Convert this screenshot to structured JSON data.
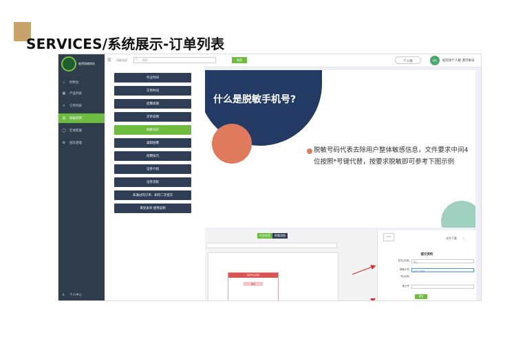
{
  "slide_title": "SERVICES/系统展示-订单列表",
  "colors": {
    "accent_square": "#c9a46a",
    "sidebar": "#2e3c4c",
    "green": "#6dbb3f",
    "navy_button": "#2f3d55",
    "orange": "#e07a5c",
    "navy_shape": "#233b64",
    "teal": "#9fcfbe"
  },
  "sidebar": {
    "logo_text": "蛙壳网络科技",
    "items": [
      {
        "label": "控制台",
        "icon": "home-icon"
      },
      {
        "label": "产品列表",
        "icon": "grid-icon"
      },
      {
        "label": "订单列表",
        "icon": "list-icon"
      },
      {
        "label": "班报说明",
        "icon": "document-icon",
        "active": true
      },
      {
        "label": "在线客服",
        "icon": "user-icon"
      },
      {
        "label": "团队管理",
        "icon": "team-icon"
      }
    ],
    "footer": {
      "label": "个人中心",
      "icon": "person-icon"
    }
  },
  "topbar": {
    "select_label": "班级全部",
    "search_placeholder": "搜索",
    "search_button": "搜索",
    "personal_button": "个人版",
    "avatar_text": "蛙壳",
    "user_label": "蛙壳场个人版-演示账号"
  },
  "menu": {
    "items": [
      {
        "label": "作业时间"
      },
      {
        "label": "交单时间"
      },
      {
        "label": "结算周期"
      },
      {
        "label": "交单说明"
      },
      {
        "label": "脱敏号码",
        "active": true
      },
      {
        "label": "兼职招聘"
      },
      {
        "label": "招聘技巧"
      },
      {
        "label": "证券介绍"
      },
      {
        "label": "证券流程"
      },
      {
        "label": "未通过的订单、如何二次提交"
      },
      {
        "label": "黄亮表单 使用说明"
      }
    ]
  },
  "slide": {
    "question": "什么是脱敏手机号?",
    "description": "脱敏号码代表去除用户整体敏感信息，文件要求中间4位按照*号键代替，按要求脱敏即可参考下图示例"
  },
  "lower": {
    "tabs": [
      "作业信息",
      "附属流程"
    ],
    "phone_card_header": "提交作业详情",
    "phone_card_button": "验证",
    "form": {
      "logo": "LOGO",
      "download_label": "文件下载",
      "title": "提交资料",
      "rows": [
        {
          "label": "姓名(必填)",
          "value": "张三"
        },
        {
          "label": "脱敏手机",
          "value": "132****8006"
        },
        {
          "label": "号(必填)",
          "value": ""
        },
        {
          "label": "营业号",
          "value": ""
        }
      ],
      "submit": "提交"
    }
  }
}
